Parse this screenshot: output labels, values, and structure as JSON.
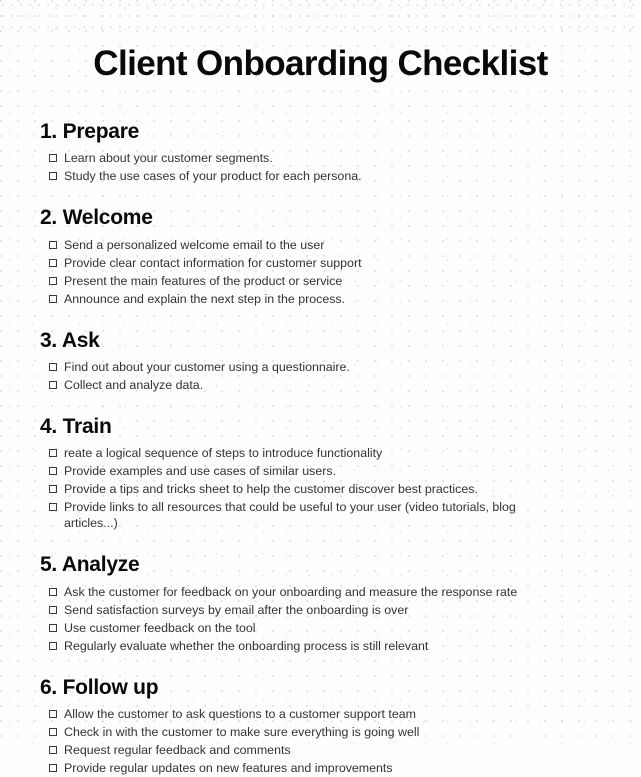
{
  "document": {
    "title": "Client Onboarding Checklist"
  },
  "sections": [
    {
      "heading": "1. Prepare",
      "items": [
        "Learn about your customer segments.",
        "Study the use cases of your product for each persona."
      ]
    },
    {
      "heading": "2. Welcome",
      "items": [
        "Send a personalized welcome email to the user",
        "Provide clear contact information for customer support",
        "Present the main features of the product or service",
        "Announce and explain the next step in the process."
      ]
    },
    {
      "heading": "3. Ask",
      "items": [
        "Find out about your customer using a questionnaire.",
        "Collect and analyze data."
      ]
    },
    {
      "heading": "4. Train",
      "items": [
        "reate a logical sequence of steps to introduce functionality",
        "Provide examples and use cases of similar users.",
        "Provide a tips and tricks sheet to help the customer discover best practices.",
        "Provide links to all resources that could be useful to your user (video tutorials, blog articles...)"
      ]
    },
    {
      "heading": "5. Analyze",
      "items": [
        "Ask the customer for feedback on your onboarding and measure the response rate",
        "Send satisfaction surveys by email after the onboarding is over",
        "Use customer feedback on the tool",
        "Regularly evaluate whether the onboarding process is still relevant"
      ]
    },
    {
      "heading": "6. Follow up",
      "items": [
        "Allow the customer to ask questions to a customer support team",
        "Check in with the customer to make sure everything is going well",
        "Request regular feedback and comments",
        "Provide regular updates on new features and improvements"
      ]
    }
  ],
  "colors": {
    "page_background": "#fdfdfd",
    "heading_text": "#0a0a0a",
    "body_text": "#333335",
    "checkbox_border": "#3a3a3c"
  }
}
